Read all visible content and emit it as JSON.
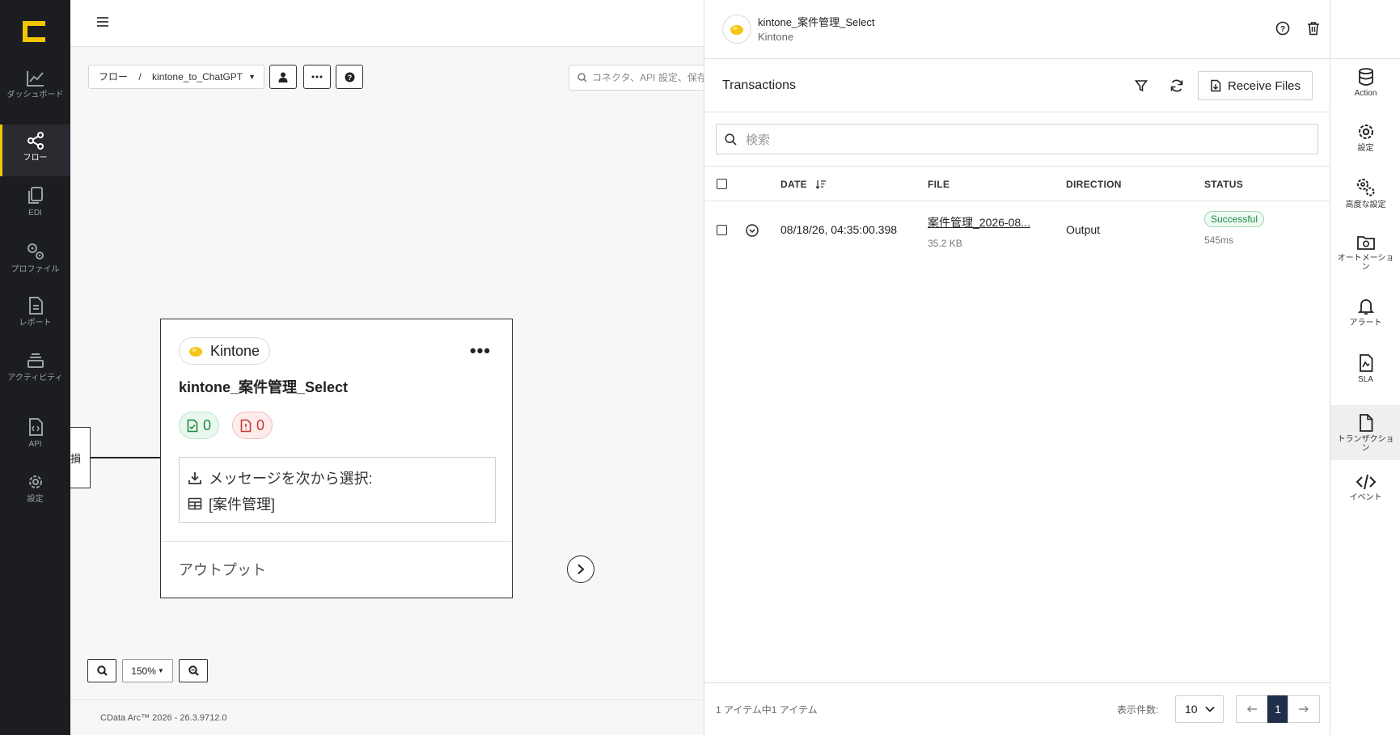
{
  "colors": {
    "accent": "#f2c600",
    "nav_bg": "#1c1d21",
    "success": "#1d8a42",
    "error": "#c23a3a",
    "page_active": "#1f2e4a"
  },
  "nav": {
    "items": [
      {
        "label": "ダッシュボード",
        "icon": "chart-line-icon"
      },
      {
        "label": "フロー",
        "icon": "share-nodes-icon"
      },
      {
        "label": "EDI",
        "icon": "documents-icon"
      },
      {
        "label": "プロファイル",
        "icon": "gears-icon"
      },
      {
        "label": "レポート",
        "icon": "report-icon"
      },
      {
        "label": "アクティビティ",
        "icon": "layers-icon"
      },
      {
        "label": "API",
        "icon": "api-file-icon"
      },
      {
        "label": "設定",
        "icon": "gear-icon"
      }
    ],
    "active_index": 1
  },
  "toolbar": {
    "breadcrumb_root": "フロー",
    "breadcrumb_sep": "/",
    "flow_name": "kintone_to_ChatGPT",
    "search_placeholder": "コネクタ、API 設定、保存"
  },
  "node": {
    "connector_type": "Kintone",
    "title": "kintone_案件管理_Select",
    "success_count": "0",
    "error_count": "0",
    "message_label": "メッセージを次から選択:",
    "table_label": "[案件管理]",
    "output_label": "アウトプット"
  },
  "left_node_partial_text": "損",
  "zoom": {
    "level": "150%"
  },
  "footer": {
    "version": "CData Arc™ 2026 - 26.3.9712.0"
  },
  "panel": {
    "title": "kintone_案件管理_Select",
    "subtitle": "Kintone",
    "section_title": "Transactions",
    "receive_files": "Receive Files",
    "search_placeholder": "検索",
    "columns": {
      "date": "DATE",
      "file": "FILE",
      "direction": "DIRECTION",
      "status": "STATUS"
    },
    "rows": [
      {
        "date": "08/18/26, 04:35:00.398",
        "file": "案件管理_2026-08...",
        "size": "35.2 KB",
        "direction": "Output",
        "status": "Successful",
        "duration": "545ms"
      }
    ],
    "pager": {
      "count_text": "1 アイテム中1 アイテム",
      "per_page_label": "表示件数:",
      "per_page": "10",
      "current_page": "1"
    }
  },
  "rail": {
    "items": [
      {
        "label": "Action",
        "icon": "database-icon"
      },
      {
        "label": "設定",
        "icon": "gear-icon"
      },
      {
        "label": "高度な設定",
        "icon": "gears-icon"
      },
      {
        "label": "オートメーション",
        "icon": "folder-gear-icon"
      },
      {
        "label": "アラート",
        "icon": "bell-icon"
      },
      {
        "label": "SLA",
        "icon": "sla-file-icon"
      },
      {
        "label": "トランザクション",
        "icon": "file-icon"
      },
      {
        "label": "イベント",
        "icon": "code-icon"
      }
    ],
    "active_index": 6
  }
}
